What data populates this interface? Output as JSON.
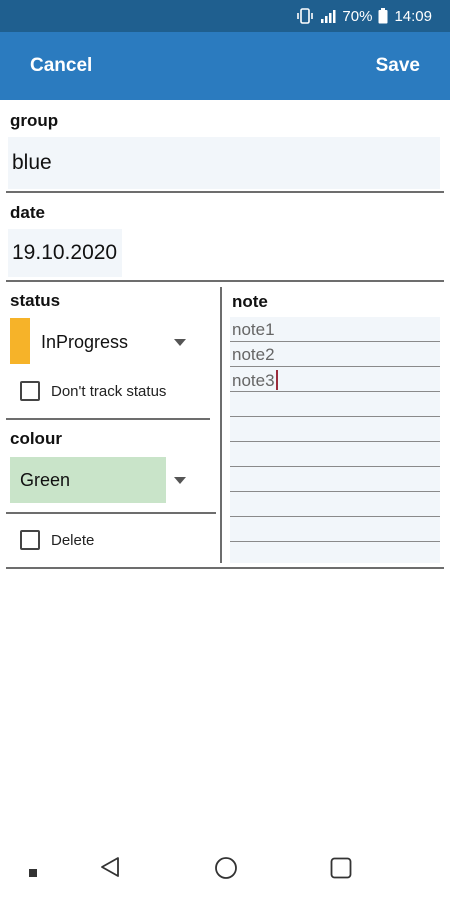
{
  "statusbar": {
    "battery": "70%",
    "time": "14:09"
  },
  "actionbar": {
    "cancel": "Cancel",
    "save": "Save"
  },
  "group": {
    "label": "group",
    "value": "blue"
  },
  "date": {
    "label": "date",
    "value": "19.10.2020"
  },
  "status": {
    "label": "status",
    "selected": "InProgress",
    "color": "#f6b329",
    "dont_track_label": "Don't track status",
    "dont_track_checked": false
  },
  "colour": {
    "label": "colour",
    "selected": "Green",
    "color": "#c9e4c9"
  },
  "delete": {
    "label": "Delete",
    "checked": false
  },
  "note": {
    "label": "note",
    "lines": [
      "note1",
      "note2",
      "note3"
    ]
  },
  "navbar": {
    "icons": [
      "menu-dot-icon",
      "back-icon",
      "home-icon",
      "recents-icon"
    ]
  }
}
